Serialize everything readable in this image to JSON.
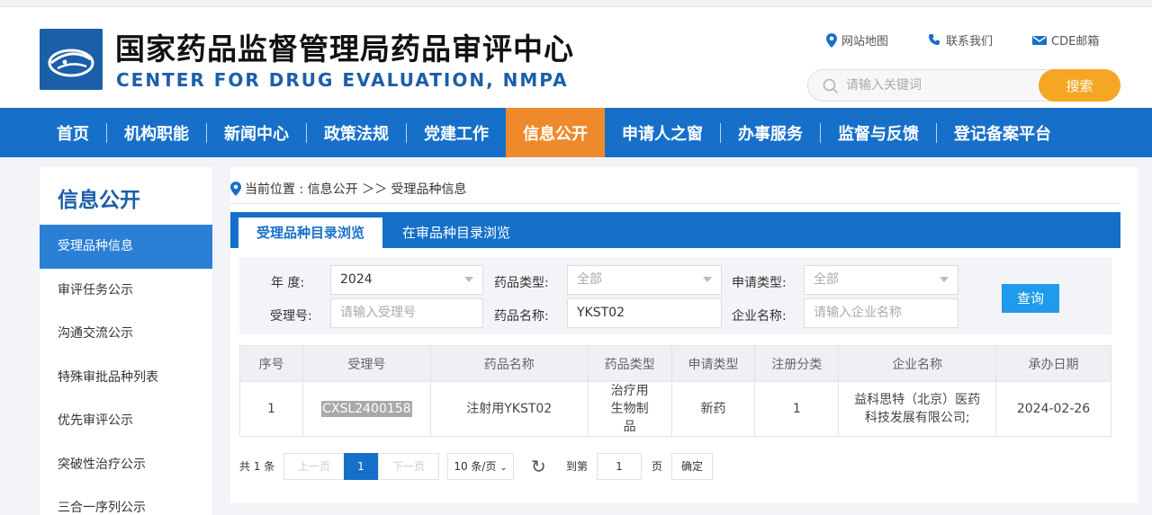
{
  "header": {
    "title_cn": "国家药品监督管理局药品审评中心",
    "title_en": "CENTER FOR DRUG EVALUATION, NMPA",
    "links": [
      {
        "label": "网站地图",
        "icon": "location-pin-icon"
      },
      {
        "label": "联系我们",
        "icon": "phone-icon"
      },
      {
        "label": "CDE邮箱",
        "icon": "mail-icon"
      }
    ],
    "search": {
      "placeholder": "请输入关键词",
      "button": "搜索"
    }
  },
  "nav": {
    "items": [
      "首页",
      "机构职能",
      "新闻中心",
      "政策法规",
      "党建工作",
      "信息公开",
      "申请人之窗",
      "办事服务",
      "监督与反馈",
      "登记备案平台"
    ],
    "active_index": 5
  },
  "colors": {
    "brand_blue": "#1670c9",
    "active_orange": "#ee8a2c",
    "search_orange": "#f5a623",
    "query_blue": "#1e9bea"
  },
  "sidebar": {
    "title": "信息公开",
    "items": [
      "受理品种信息",
      "审评任务公示",
      "沟通交流公示",
      "特殊审批品种列表",
      "优先审评公示",
      "突破性治疗公示",
      "三合一序列公示"
    ],
    "active_index": 0
  },
  "breadcrumb": {
    "text": "当前位置 : 信息公开 ＞＞ 受理品种信息"
  },
  "tabs": [
    "受理品种目录浏览",
    "在审品种目录浏览"
  ],
  "filter": {
    "year_label": "年    度:",
    "year_value": "2024",
    "drug_type_label": "药品类型:",
    "drug_type_value": "全部",
    "apply_type_label": "申请类型:",
    "apply_type_value": "全部",
    "accept_no_label": "受理号:",
    "accept_no_placeholder": "请输入受理号",
    "drug_name_label": "药品名称:",
    "drug_name_value": "YKST02",
    "company_label": "企业名称:",
    "company_placeholder": "请输入企业名称",
    "query_button": "查询"
  },
  "table": {
    "headers": [
      "序号",
      "受理号",
      "药品名称",
      "药品类型",
      "申请类型",
      "注册分类",
      "企业名称",
      "承办日期"
    ],
    "rows": [
      [
        "1",
        "CXSL2400158",
        "注射用YKST02",
        "治疗用生物制品",
        "新药",
        "1",
        "益科思特（北京）医药科技发展有限公司;",
        "2024-02-26"
      ]
    ]
  },
  "pager": {
    "total": "共 1 条",
    "prev": "上一页",
    "current": "1",
    "next": "下一页",
    "page_size": "10 条/页",
    "goto_label": "到第",
    "goto_value": "1",
    "page_unit": "页",
    "confirm": "确定"
  }
}
